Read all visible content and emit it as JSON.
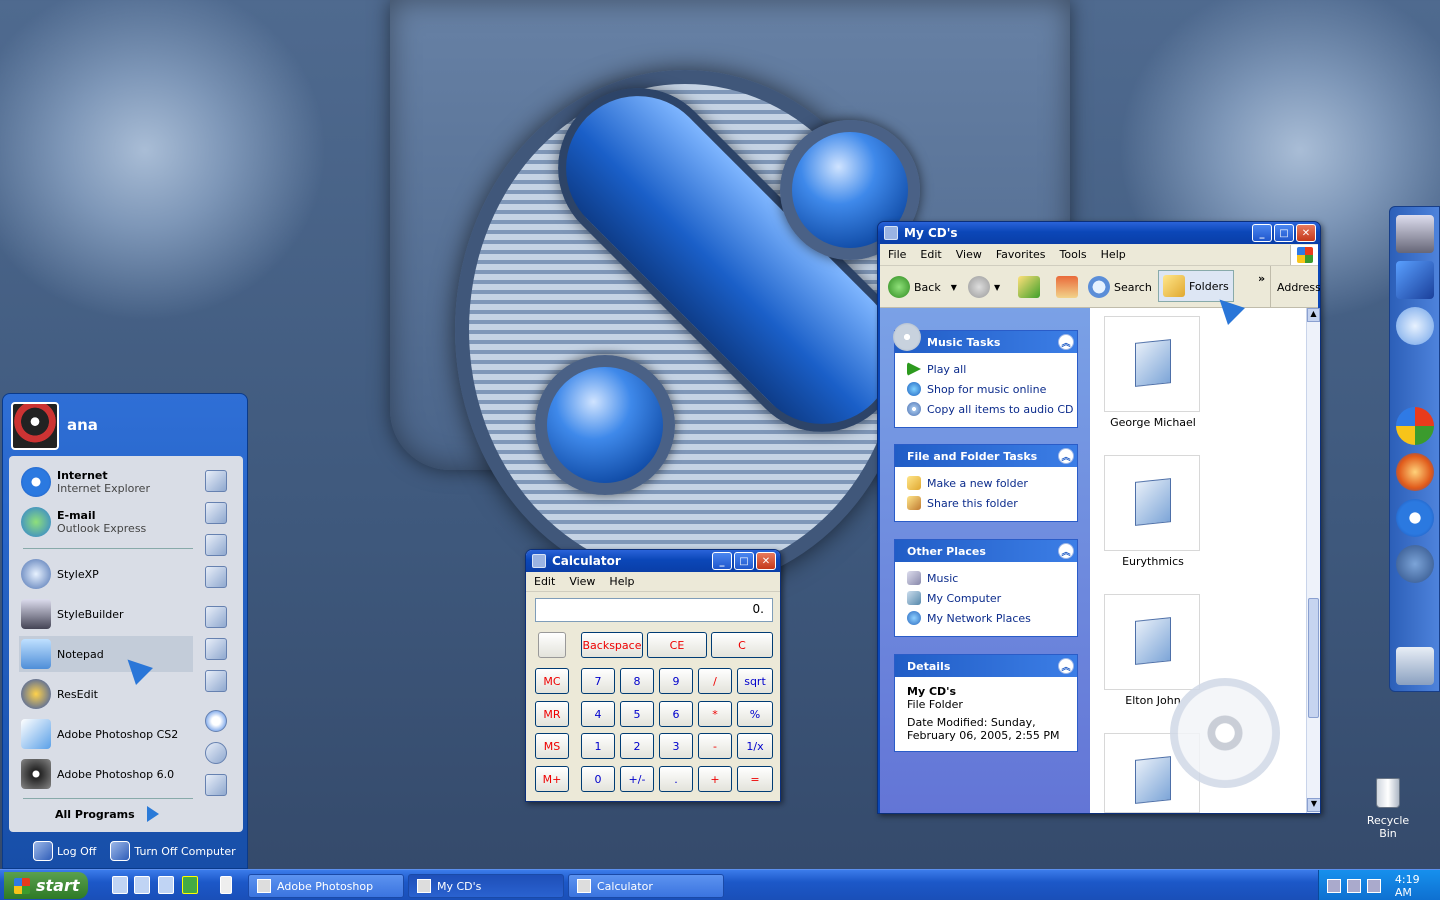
{
  "calculator": {
    "title": "Calculator",
    "menu": [
      "Edit",
      "View",
      "Help"
    ],
    "display": "0.",
    "top_buttons": [
      "Backspace",
      "CE",
      "C"
    ],
    "memory_buttons": [
      "MC",
      "MR",
      "MS",
      "M+"
    ],
    "rows": [
      [
        "7",
        "8",
        "9",
        "/",
        "sqrt"
      ],
      [
        "4",
        "5",
        "6",
        "*",
        "%"
      ],
      [
        "1",
        "2",
        "3",
        "-",
        "1/x"
      ],
      [
        "0",
        "+/-",
        ".",
        "+",
        "="
      ]
    ]
  },
  "explorer": {
    "title": "My CD's",
    "menu": [
      "File",
      "Edit",
      "View",
      "Favorites",
      "Tools",
      "Help"
    ],
    "toolbar": {
      "back": "Back",
      "search": "Search",
      "folders": "Folders",
      "more": "»",
      "address": "Address"
    },
    "music_tasks": {
      "title": "Music Tasks",
      "items": [
        "Play all",
        "Shop for music online",
        "Copy all items to audio CD"
      ]
    },
    "file_tasks": {
      "title": "File and Folder Tasks",
      "items": [
        "Make a new folder",
        "Share this folder"
      ]
    },
    "other_places": {
      "title": "Other Places",
      "items": [
        "Music",
        "My Computer",
        "My Network Places"
      ]
    },
    "details": {
      "title": "Details",
      "name": "My CD's",
      "type": "File Folder",
      "modified": "Date Modified: Sunday,",
      "modified_date": "February 06, 2005, 2:55 PM"
    },
    "folders": [
      "George Michael",
      "Eurythmics",
      "Elton John",
      ""
    ]
  },
  "start_menu": {
    "user": "ana",
    "pinned": [
      {
        "title": "Internet",
        "sub": "Internet Explorer"
      },
      {
        "title": "E-mail",
        "sub": "Outlook Express"
      }
    ],
    "recent": [
      "StyleXP",
      "StyleBuilder",
      "Notepad",
      "ResEdit",
      "Adobe Photoshop CS2",
      "Adobe Photoshop 6.0"
    ],
    "all_programs": "All Programs",
    "log_off": "Log Off",
    "turn_off": "Turn Off Computer"
  },
  "taskbar": {
    "start": "start",
    "tasks": [
      "Adobe Photoshop",
      "My CD's",
      "Calculator"
    ],
    "clock": "4:19 AM"
  },
  "desktop": {
    "recycle_bin": "Recycle Bin"
  }
}
